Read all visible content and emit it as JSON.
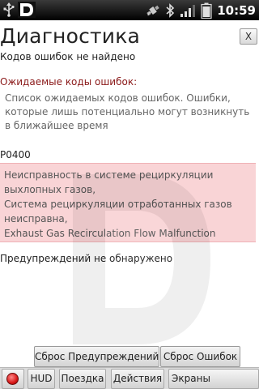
{
  "status_bar": {
    "time": "10:59",
    "icons": [
      "usb-icon",
      "app-logo-icon",
      "gps-icon",
      "bluetooth-icon",
      "signal-icon",
      "battery-icon"
    ],
    "background_color": "#000000"
  },
  "header": {
    "title": "Диагностика",
    "close_label": "X"
  },
  "errors": {
    "none_found": "Кодов ошибок не найдено"
  },
  "expected": {
    "header": "Ожидаемые коды ошибок:",
    "description": "Список ожидаемых кодов ошибок. Ошибки, которые лишь потенциально могут возникнуть в ближайшее время",
    "header_color": "#8b1a1a"
  },
  "expected_codes": [
    {
      "code": "P0400",
      "lines": [
        "Неисправность в системе рециркуляции выхлопных газов,",
        "Система рециркуляции отработанных газов неисправна,",
        "Exhaust Gas Recirculation Flow Malfunction"
      ],
      "highlight_color": "#f9d4d6"
    }
  ],
  "warnings": {
    "none_found": "Предупреждений не обнаружено"
  },
  "actions": {
    "reset_warnings": "Сброс Предупреждений",
    "reset_errors": "Сброс Ошибок"
  },
  "tabs": {
    "status_indicator_color": "#d81818",
    "hud": "HUD",
    "trip": "Поездка",
    "actions": "Действия",
    "screens": "Экраны"
  }
}
